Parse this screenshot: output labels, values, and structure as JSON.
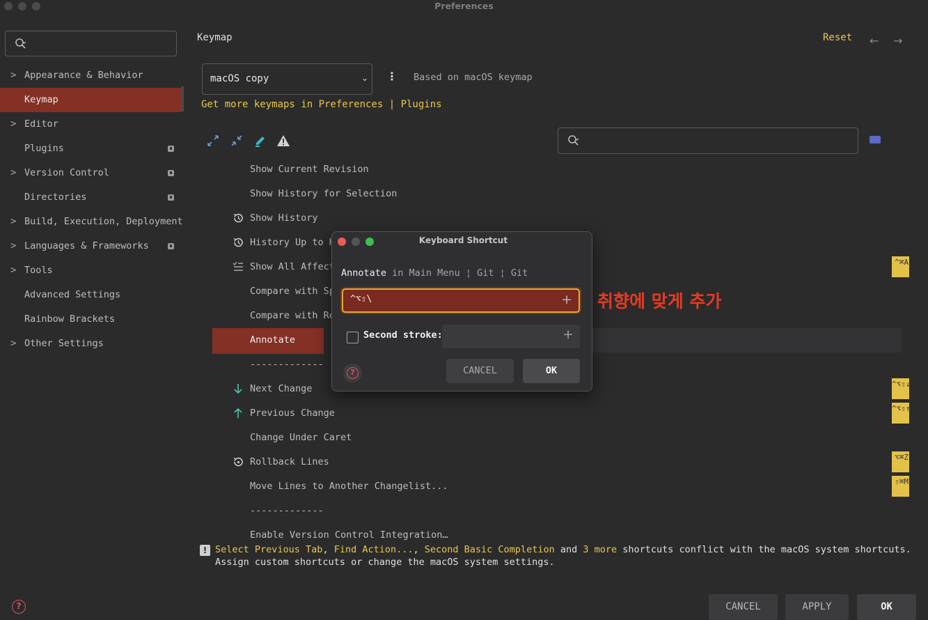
{
  "window": {
    "title": "Preferences"
  },
  "sidebar": {
    "search": {
      "value": "",
      "placeholder": ""
    },
    "items": [
      {
        "label": "Appearance & Behavior",
        "expandable": true,
        "badge": false
      },
      {
        "label": "Keymap",
        "expandable": false,
        "badge": false,
        "selected": true
      },
      {
        "label": "Editor",
        "expandable": true,
        "badge": false
      },
      {
        "label": "Plugins",
        "expandable": false,
        "badge": true
      },
      {
        "label": "Version Control",
        "expandable": true,
        "badge": true
      },
      {
        "label": "Directories",
        "expandable": false,
        "badge": true
      },
      {
        "label": "Build, Execution, Deployment",
        "expandable": true,
        "badge": false
      },
      {
        "label": "Languages & Frameworks",
        "expandable": true,
        "badge": true
      },
      {
        "label": "Tools",
        "expandable": true,
        "badge": false
      },
      {
        "label": "Advanced Settings",
        "expandable": false,
        "badge": false
      },
      {
        "label": "Rainbow Brackets",
        "expandable": false,
        "badge": false
      },
      {
        "label": "Other Settings",
        "expandable": true,
        "badge": false
      }
    ]
  },
  "main": {
    "title": "Keymap",
    "reset_label": "Reset",
    "keymap_select": {
      "value": "macOS copy"
    },
    "based_on": "Based on macOS keymap",
    "get_more": "Get more keymaps in Preferences | Plugins",
    "filter": {
      "value": "",
      "placeholder": ""
    },
    "rows": [
      {
        "label": "Show Current Revision",
        "icon": "",
        "shortcut": ""
      },
      {
        "label": "Show History for Selection",
        "icon": "",
        "shortcut": ""
      },
      {
        "label": "Show History",
        "icon": "history-icon",
        "shortcut": ""
      },
      {
        "label": "History Up to He",
        "icon": "history-icon",
        "shortcut": ""
      },
      {
        "label": "Show All Affecte",
        "icon": "list-check-icon",
        "shortcut": "^⌘A"
      },
      {
        "label": "Compare with Spe",
        "icon": "",
        "shortcut": ""
      },
      {
        "label": "Compare with Rev",
        "icon": "",
        "shortcut": ""
      },
      {
        "label": "Annotate",
        "icon": "",
        "shortcut": "",
        "selected": true
      },
      {
        "label": "-------------",
        "icon": "",
        "shortcut": ""
      },
      {
        "label": "Next Change",
        "icon": "arrow-down-icon",
        "shortcut": "^⌥⇧↓"
      },
      {
        "label": "Previous Change",
        "icon": "arrow-up-icon",
        "shortcut": "^⌥⇧↑"
      },
      {
        "label": "Change Under Caret",
        "icon": "",
        "shortcut": ""
      },
      {
        "label": "Rollback Lines",
        "icon": "rollback-icon",
        "shortcut": "⌥⌘Z"
      },
      {
        "label": "Move Lines to Another Changelist...",
        "icon": "",
        "shortcut": "⇧⌘M"
      },
      {
        "label": "-------------",
        "icon": "",
        "shortcut": ""
      },
      {
        "label": "Enable Version Control Integration…",
        "icon": "",
        "shortcut": ""
      }
    ],
    "warning": {
      "p1": "Select Previous Tab",
      "s1": ", ",
      "p2": "Find Action...",
      "s2": ", ",
      "p3": "Second Basic Completion",
      "s3": " and ",
      "p4": "3 more",
      "s4": " shortcuts conflict with the macOS system shortcuts.",
      "line2": "Assign custom shortcuts or change the macOS system settings."
    }
  },
  "footer": {
    "cancel": "CANCEL",
    "apply": "APPLY",
    "ok": "OK"
  },
  "dialog": {
    "title": "Keyboard Shortcut",
    "action_name": "Annotate",
    "action_path": " in Main Menu ¦ Git ¦ Git",
    "first_stroke_value": "^⌥⇧\\",
    "second_stroke_label": "Second stroke:",
    "second_stroke_value": "",
    "cancel": "CANCEL",
    "ok": "OK"
  },
  "annotation_note": "취향에 맞게 추가",
  "colors": {
    "accent_selection": "#843025",
    "link_yellow": "#e8c74b",
    "annotation_red": "#e53a22",
    "shortcut_chip": "#e3c24a"
  }
}
